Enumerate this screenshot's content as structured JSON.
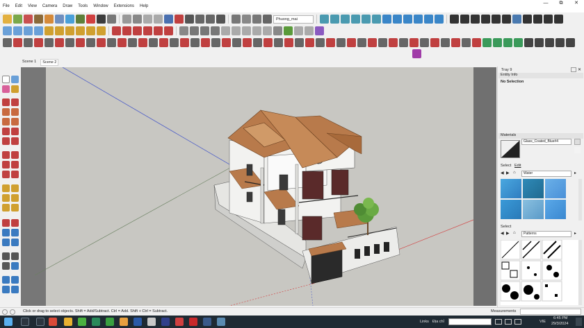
{
  "menu": [
    "File",
    "Edit",
    "View",
    "Camera",
    "Draw",
    "Tools",
    "Window",
    "Extensions",
    "Help"
  ],
  "window_controls": [
    "—",
    "⧉",
    "✕"
  ],
  "toolbar": {
    "style_dropdown": "Phuong_mai"
  },
  "scenes": [
    "Scene 1",
    "Scene 2"
  ],
  "tray": {
    "title": "Tray 9",
    "entity_info": {
      "header": "Entity Info",
      "selection": "No Selection"
    },
    "materials": {
      "header": "Materials",
      "name": "Glass_Coated_Blue#4",
      "tabs": [
        "Select",
        "Edit"
      ],
      "library": "Water",
      "select2_label": "Select",
      "library2": "Patterns"
    }
  },
  "status": {
    "hint": "Click or drag to select objects. Shift = Add/Subtract. Ctrl = Add. Shift + Ctrl = Subtract.",
    "measurements_label": "Measurements"
  },
  "taskbar": {
    "links_label": "Links",
    "address_label": "Địa chỉ",
    "language": "VIE",
    "time": "6:45 PM",
    "date": "29/3/2024"
  },
  "colors": {
    "viewport_bg": "#c8c7c2",
    "roof": "#b87a4b",
    "wall": "#f2f2f0",
    "taskbar": "#1f2a33",
    "axis_red": "#d24a4a",
    "axis_blue": "#5060c8",
    "water_blue": "#3a9ad8"
  }
}
